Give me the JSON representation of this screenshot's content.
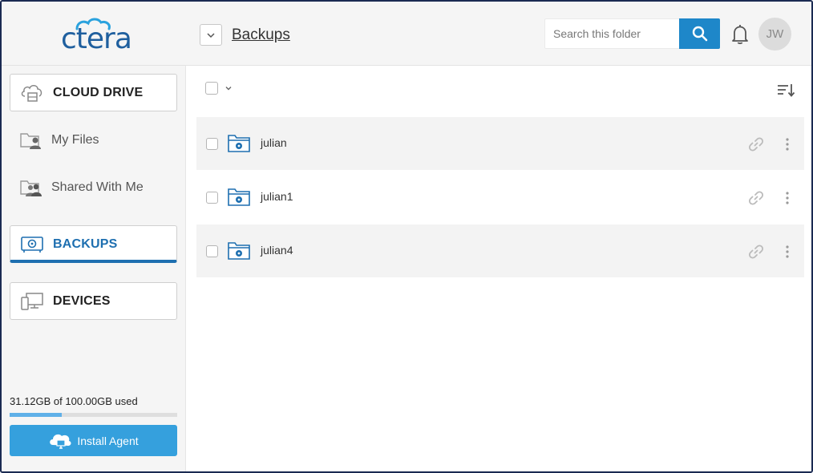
{
  "app": {
    "brand_icon": "ctera-logo",
    "brand_text": "ctera"
  },
  "header": {
    "breadcrumb": "Backups",
    "search_placeholder": "Search this folder",
    "avatar_initials": "JW"
  },
  "sidebar": {
    "cloud_drive": "CLOUD DRIVE",
    "my_files": "My Files",
    "shared_with_me": "Shared With Me",
    "backups": "BACKUPS",
    "devices": "DEVICES",
    "usage_text": "31.12GB of 100.00GB used",
    "usage_fraction": 0.3112,
    "install_agent": "Install Agent"
  },
  "files": [
    {
      "name": "julian"
    },
    {
      "name": "julian1"
    },
    {
      "name": "julian4"
    }
  ],
  "colors": {
    "accent": "#1e6fb0",
    "search_button": "#1e87c9",
    "install_button": "#35a0dd"
  }
}
